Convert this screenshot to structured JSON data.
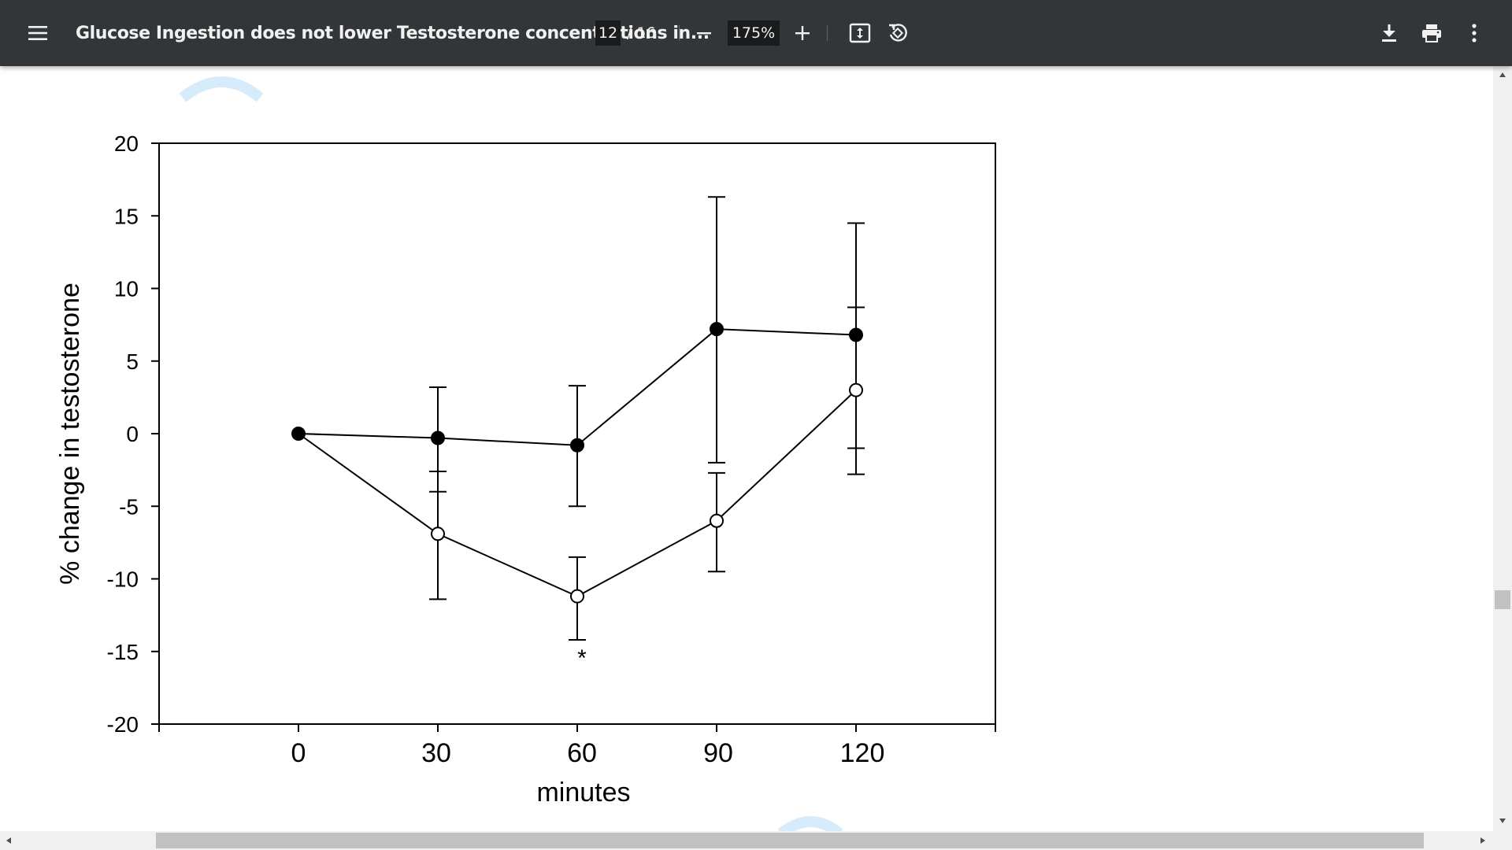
{
  "toolbar": {
    "menu_icon": "hamburger-menu-icon",
    "title": "Glucose Ingestion does not lower Testosterone concentrations in...",
    "page_current": "12",
    "page_total": "/ 16",
    "zoom": "175%",
    "icons": [
      "minus-icon",
      "plus-icon",
      "fit-page-icon",
      "rotate-icon",
      "download-icon",
      "print-icon",
      "more-vert-icon"
    ]
  },
  "colors": {
    "toolbar_bg": "#323639",
    "watermark": "#d6ecfb"
  },
  "chart_data": {
    "type": "line",
    "xlabel": "minutes",
    "ylabel": "% change in testosterone",
    "x": [
      0,
      30,
      60,
      90,
      120
    ],
    "xticks": [
      "0",
      "30",
      "60",
      "90",
      "120"
    ],
    "yticks": [
      "20",
      "15",
      "10",
      "5",
      "0",
      "-5",
      "-10",
      "-15",
      "-20"
    ],
    "xlim": [
      -30,
      150
    ],
    "ylim": [
      -20,
      20
    ],
    "series": [
      {
        "marker": "filled-circle",
        "values": [
          0,
          -0.3,
          -0.8,
          7.2,
          6.8
        ],
        "err_upper": [
          0,
          3.2,
          3.3,
          16.3,
          14.5
        ],
        "err_lower": [
          0,
          -4.0,
          -5.0,
          -2.0,
          -1.0
        ]
      },
      {
        "marker": "open-circle",
        "values": [
          0,
          -6.9,
          -11.2,
          -6.0,
          3.0
        ],
        "err_upper": [
          0,
          -2.6,
          -8.5,
          -2.7,
          8.7
        ],
        "err_lower": [
          0,
          -11.4,
          -14.2,
          -9.5,
          -2.8
        ]
      }
    ],
    "annotations": [
      {
        "x": 60,
        "text": "*"
      }
    ]
  }
}
